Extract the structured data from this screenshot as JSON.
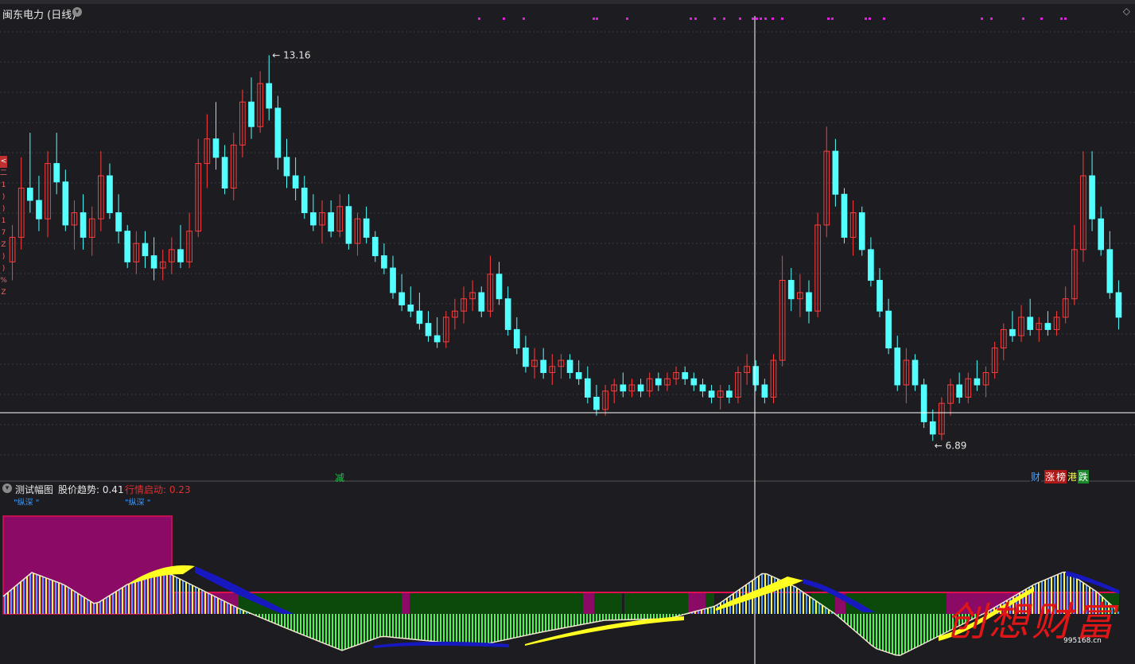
{
  "header": {
    "title": "闽东电力 (日线)",
    "arrow_icon": "chevron-down-icon",
    "corner_icon": "diamond-icon"
  },
  "side_tabs": [
    "<",
    "二",
    "1",
    ")",
    ")",
    "1",
    "7",
    "Z",
    ")",
    ")",
    "%",
    "Z"
  ],
  "price_panel": {
    "high_label": "13.16",
    "low_label": "6.89",
    "label_jian": "减",
    "tags": [
      {
        "text": "财",
        "color": "#4aa0ff",
        "bg": "#1c1c21"
      },
      {
        "text": "涨",
        "color": "#ffffff",
        "bg": "#b01818"
      },
      {
        "text": "榜",
        "color": "#ffffff",
        "bg": "#b01818"
      },
      {
        "text": "港",
        "color": "#ffff40",
        "bg": "#1c1c21"
      },
      {
        "text": "跌",
        "color": "#ffffff",
        "bg": "#1a8a2a"
      }
    ]
  },
  "indicator": {
    "name": "测试幅图",
    "v1_label": "股价趋势: 0.41",
    "v2_label": "行情启动: 0.23",
    "sub1": "\"纵深 \"",
    "sub2": "\"纵深 \""
  },
  "watermark": {
    "text": "创想财富",
    "url": "995168.cn"
  },
  "colors": {
    "up": "#ff3c3c",
    "down": "#54ffff",
    "bg": "#1c1c21",
    "grid": "#3a3a44",
    "magenta": "#e020e0"
  },
  "chart_data": {
    "type": "candlestick",
    "high": 13.16,
    "low": 6.89,
    "ylim": [
      6.3,
      13.8
    ],
    "candles": [
      [
        9.8,
        10.4,
        9.5,
        10.2
      ],
      [
        10.2,
        11.5,
        10.0,
        11.0
      ],
      [
        11.0,
        11.9,
        10.6,
        10.8
      ],
      [
        10.8,
        11.2,
        10.3,
        10.5
      ],
      [
        10.5,
        11.6,
        10.2,
        11.4
      ],
      [
        11.4,
        11.9,
        10.9,
        11.1
      ],
      [
        11.1,
        11.3,
        10.3,
        10.4
      ],
      [
        10.4,
        10.8,
        10.0,
        10.6
      ],
      [
        10.6,
        10.9,
        10.0,
        10.2
      ],
      [
        10.2,
        10.7,
        9.9,
        10.5
      ],
      [
        10.5,
        11.6,
        10.3,
        11.2
      ],
      [
        11.2,
        11.4,
        10.5,
        10.6
      ],
      [
        10.6,
        10.9,
        10.1,
        10.3
      ],
      [
        10.3,
        10.4,
        9.7,
        9.8
      ],
      [
        9.8,
        10.3,
        9.6,
        10.1
      ],
      [
        10.1,
        10.3,
        9.7,
        9.9
      ],
      [
        9.9,
        10.2,
        9.5,
        9.7
      ],
      [
        9.7,
        10.0,
        9.5,
        9.8
      ],
      [
        9.8,
        10.2,
        9.6,
        10.0
      ],
      [
        10.0,
        10.4,
        9.7,
        9.8
      ],
      [
        9.8,
        10.6,
        9.7,
        10.3
      ],
      [
        10.3,
        11.8,
        10.2,
        11.4
      ],
      [
        11.4,
        12.2,
        11.0,
        11.8
      ],
      [
        11.8,
        12.4,
        11.3,
        11.5
      ],
      [
        11.5,
        11.7,
        10.9,
        11.0
      ],
      [
        11.0,
        11.9,
        10.8,
        11.7
      ],
      [
        11.7,
        12.6,
        11.5,
        12.4
      ],
      [
        12.4,
        12.8,
        11.8,
        12.0
      ],
      [
        12.0,
        12.9,
        11.9,
        12.7
      ],
      [
        12.7,
        13.16,
        12.1,
        12.3
      ],
      [
        12.3,
        12.5,
        11.3,
        11.5
      ],
      [
        11.5,
        11.8,
        11.0,
        11.2
      ],
      [
        11.2,
        11.5,
        10.8,
        11.0
      ],
      [
        11.0,
        11.2,
        10.5,
        10.6
      ],
      [
        10.6,
        10.9,
        10.3,
        10.4
      ],
      [
        10.4,
        10.8,
        10.1,
        10.6
      ],
      [
        10.6,
        10.8,
        10.2,
        10.3
      ],
      [
        10.3,
        10.9,
        10.2,
        10.7
      ],
      [
        10.7,
        10.9,
        10.0,
        10.1
      ],
      [
        10.1,
        10.6,
        9.9,
        10.5
      ],
      [
        10.5,
        10.7,
        10.1,
        10.2
      ],
      [
        10.2,
        10.3,
        9.8,
        9.9
      ],
      [
        9.9,
        10.1,
        9.6,
        9.7
      ],
      [
        9.7,
        9.9,
        9.2,
        9.3
      ],
      [
        9.3,
        9.6,
        9.0,
        9.1
      ],
      [
        9.1,
        9.4,
        8.9,
        9.0
      ],
      [
        9.0,
        9.3,
        8.7,
        8.8
      ],
      [
        8.8,
        9.0,
        8.5,
        8.6
      ],
      [
        8.6,
        8.9,
        8.4,
        8.5
      ],
      [
        8.5,
        9.0,
        8.4,
        8.9
      ],
      [
        8.9,
        9.2,
        8.7,
        9.0
      ],
      [
        9.0,
        9.4,
        8.8,
        9.2
      ],
      [
        9.2,
        9.5,
        9.0,
        9.3
      ],
      [
        9.3,
        9.4,
        8.9,
        9.0
      ],
      [
        9.0,
        9.9,
        8.9,
        9.6
      ],
      [
        9.6,
        9.8,
        9.1,
        9.2
      ],
      [
        9.2,
        9.4,
        8.6,
        8.7
      ],
      [
        8.7,
        8.9,
        8.3,
        8.4
      ],
      [
        8.4,
        8.6,
        8.0,
        8.1
      ],
      [
        8.1,
        8.4,
        7.9,
        8.2
      ],
      [
        8.2,
        8.4,
        7.9,
        8.0
      ],
      [
        8.0,
        8.3,
        7.8,
        8.1
      ],
      [
        8.1,
        8.3,
        7.9,
        8.2
      ],
      [
        8.2,
        8.3,
        7.9,
        8.0
      ],
      [
        8.0,
        8.2,
        7.8,
        7.9
      ],
      [
        7.9,
        8.1,
        7.5,
        7.6
      ],
      [
        7.6,
        7.8,
        7.3,
        7.4
      ],
      [
        7.4,
        7.8,
        7.3,
        7.7
      ],
      [
        7.7,
        7.9,
        7.5,
        7.8
      ],
      [
        7.8,
        8.0,
        7.6,
        7.7
      ],
      [
        7.7,
        7.9,
        7.6,
        7.8
      ],
      [
        7.8,
        7.9,
        7.6,
        7.7
      ],
      [
        7.7,
        8.0,
        7.6,
        7.9
      ],
      [
        7.9,
        8.0,
        7.7,
        7.8
      ],
      [
        7.8,
        8.0,
        7.7,
        7.9
      ],
      [
        7.9,
        8.1,
        7.8,
        8.0
      ],
      [
        8.0,
        8.1,
        7.8,
        7.9
      ],
      [
        7.9,
        8.0,
        7.7,
        7.8
      ],
      [
        7.8,
        7.9,
        7.6,
        7.7
      ],
      [
        7.7,
        7.8,
        7.5,
        7.6
      ],
      [
        7.6,
        7.8,
        7.4,
        7.7
      ],
      [
        7.7,
        7.8,
        7.5,
        7.6
      ],
      [
        7.6,
        8.1,
        7.5,
        8.0
      ],
      [
        8.0,
        8.3,
        7.8,
        8.1
      ],
      [
        8.1,
        8.2,
        7.7,
        7.8
      ],
      [
        7.8,
        7.9,
        7.5,
        7.6
      ],
      [
        7.6,
        8.3,
        7.5,
        8.2
      ],
      [
        8.2,
        9.9,
        8.1,
        9.5
      ],
      [
        9.5,
        9.7,
        9.0,
        9.2
      ],
      [
        9.2,
        9.6,
        8.9,
        9.3
      ],
      [
        9.3,
        9.5,
        8.8,
        9.0
      ],
      [
        9.0,
        10.6,
        8.9,
        10.4
      ],
      [
        10.4,
        12.0,
        10.2,
        11.6
      ],
      [
        11.6,
        11.8,
        10.7,
        10.9
      ],
      [
        10.9,
        11.0,
        10.1,
        10.2
      ],
      [
        10.2,
        10.8,
        9.9,
        10.6
      ],
      [
        10.6,
        10.7,
        9.9,
        10.0
      ],
      [
        10.0,
        10.2,
        9.4,
        9.5
      ],
      [
        9.5,
        9.7,
        8.9,
        9.0
      ],
      [
        9.0,
        9.2,
        8.3,
        8.4
      ],
      [
        8.4,
        8.6,
        7.7,
        7.8
      ],
      [
        7.8,
        8.4,
        7.5,
        8.2
      ],
      [
        8.2,
        8.3,
        7.7,
        7.8
      ],
      [
        7.8,
        7.9,
        7.1,
        7.2
      ],
      [
        7.2,
        7.4,
        6.89,
        7.0
      ],
      [
        7.0,
        7.6,
        6.9,
        7.5
      ],
      [
        7.5,
        7.9,
        7.3,
        7.8
      ],
      [
        7.8,
        8.0,
        7.5,
        7.6
      ],
      [
        7.6,
        8.0,
        7.5,
        7.9
      ],
      [
        7.9,
        8.2,
        7.7,
        7.8
      ],
      [
        7.8,
        8.1,
        7.6,
        8.0
      ],
      [
        8.0,
        8.5,
        7.9,
        8.4
      ],
      [
        8.4,
        8.8,
        8.2,
        8.7
      ],
      [
        8.7,
        9.0,
        8.5,
        8.6
      ],
      [
        8.6,
        9.1,
        8.5,
        8.9
      ],
      [
        8.9,
        9.2,
        8.6,
        8.7
      ],
      [
        8.7,
        8.9,
        8.5,
        8.8
      ],
      [
        8.8,
        9.0,
        8.6,
        8.7
      ],
      [
        8.7,
        9.0,
        8.6,
        8.9
      ],
      [
        8.9,
        9.4,
        8.8,
        9.2
      ],
      [
        9.2,
        10.4,
        9.1,
        10.0
      ],
      [
        10.0,
        11.6,
        9.8,
        11.2
      ],
      [
        11.2,
        11.6,
        10.3,
        10.5
      ],
      [
        10.5,
        10.7,
        9.9,
        10.0
      ],
      [
        10.0,
        10.3,
        9.2,
        9.3
      ],
      [
        9.3,
        9.5,
        8.7,
        8.9
      ]
    ]
  }
}
